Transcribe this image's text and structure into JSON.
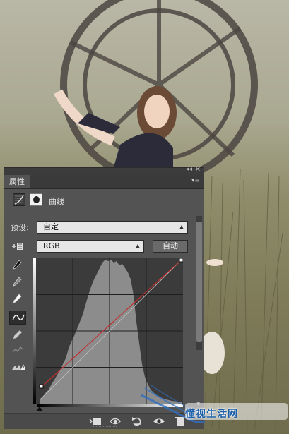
{
  "panel": {
    "tab_label": "属性",
    "collapse_glyph": "◂◂",
    "close_glyph": "✕",
    "menu_glyph": "▾≡",
    "adjustment_title": "曲线",
    "preset_label": "预设:",
    "preset_value": "自定",
    "channel_value": "RGB",
    "auto_button": "自动"
  },
  "watermark": {
    "text": "懂视生活网"
  },
  "colors": {
    "panel_bg": "#535353",
    "graph_bg": "#3b3b3b",
    "histogram": "#8c8c8c",
    "curve_line": "#c03030",
    "baseline": "#bdbdbd"
  },
  "icons": {
    "adjustment_type": "curves-layer-icon",
    "mask": "layer-mask-icon",
    "on_image_adjust": "hand-target-icon",
    "tools": [
      "eyedropper-black-icon",
      "eyedropper-gray-icon",
      "eyedropper-white-icon",
      "curve-edit-icon",
      "pencil-icon",
      "smooth-icon",
      "clipping-warning-icon"
    ],
    "bottom": [
      "clip-to-layer-icon",
      "view-previous-state-icon",
      "reset-icon",
      "visibility-eye-icon",
      "delete-icon"
    ]
  }
}
